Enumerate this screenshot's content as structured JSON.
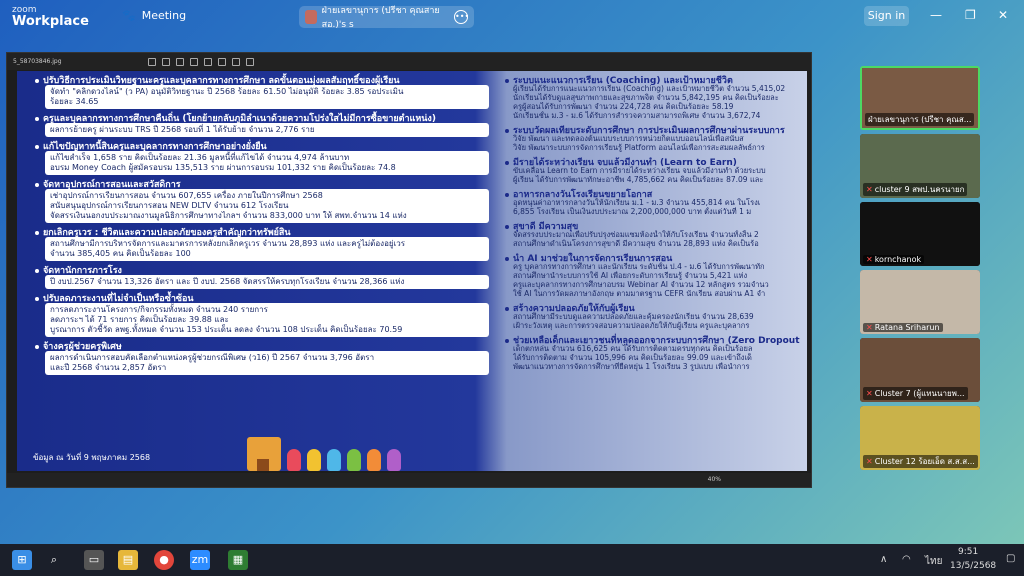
{
  "zoom": {
    "logo_line1": "zoom",
    "logo_line2": "Workplace",
    "meeting_label": "Meeting",
    "share_title": "ฝ่ายเลขานุการ (ปรีชา  คุณสาย สอ.)'s s",
    "sign_in": "Sign in",
    "win_min": "—",
    "win_restore": "❐",
    "win_close": "✕"
  },
  "viewer": {
    "filename": "5_58703846.jpg",
    "zoom_level": "40%"
  },
  "slide": {
    "left_sections": [
      {
        "heading": "ปรับวิธีการประเมินวิทยฐานะครูและบุคลากรทางการศึกษา ลดขั้นตอนมุ่งผลสัมฤทธิ์ของผู้เรียน",
        "lines": [
          "จัดทำ \"คลิกดวงไลน์\" (ว PA) อนุมัติวิทยฐานะ ปี 2568 ร้อยละ 61.50 ไม่อนุมัติ ร้อยละ 3.85 รอประเมิน",
          "ร้อยละ 34.65"
        ]
      },
      {
        "heading": "ครูและบุคลากรทางการศึกษาคืนถิ่น (โยกย้ายกลับภูมิลำเนาด้วยความโปร่งใสไม่มีการซื้อขายตำแหน่ง)",
        "lines": [
          "ผลการย้ายครู ผ่านระบบ TRS ปี 2568 รอบที่ 1 ได้รับย้าย จำนวน 2,776 ราย"
        ]
      },
      {
        "heading": "แก้ไขปัญหาหนี้สินครูและบุคลากรทางการศึกษาอย่างยั่งยืน",
        "lines": [
          "แก้ไขสำเร็จ 1,658 ราย คิดเป็นร้อยละ 21.36 มูลหนี้ที่แก้ไขได้ จำนวน 4,974 ล้านบาท",
          "อบรม Money Coach ผู้สมัครอบรม 135,513 ราย ผ่านการอบรม 101,332 ราย คิดเป็นร้อยละ 74.8"
        ]
      },
      {
        "heading": "จัดหาอุปกรณ์การสอนและสวัสดิการ",
        "lines": [
          "เช่าอุปกรณ์การเรียนการสอน จำนวน 607,655 เครื่อง ภายในปีการศึกษา 2568",
          "สนับสนุนอุปกรณ์การเรียนการสอน NEW DLTV จำนวน 612 โรงเรียน",
          "จัดสรรเงินนอกงบประมาณงานมูลนิธิการศึกษาทางไกลฯ จำนวน 833,000 บาท ให้ สพท.จำนวน 14 แห่ง"
        ]
      },
      {
        "heading": "ยกเลิกครูเวร : ชีวิตและความปลอดภัยของครูสำคัญกว่าทรัพย์สิน",
        "lines": [
          "สถานศึกษามีการบริหารจัดการและมาตรการหลังยกเลิกครูเวร จำนวน 28,893 แห่ง และครูไม่ต้องอยู่เวร",
          "จำนวน 385,405 คน คิดเป็นร้อยละ 100"
        ]
      },
      {
        "heading": "จัดหานักการภารโรง",
        "lines": [
          "ปี งบป.2567 จำนวน 13,326 อัตรา และ ปี งบป. 2568 จัดสรรให้ครบทุกโรงเรียน จำนวน 28,366 แห่ง"
        ]
      },
      {
        "heading": "ปรับลดภาระงานที่ไม่จำเป็นหรือซ้ำซ้อน",
        "lines": [
          "การลดภาระงานโครงการ/กิจกรรมทั้งหมด จำนวน 240 รายการ",
          "ลดภาระฯ ได้ 71 รายการ คิดเป็นร้อยละ 39.88 และ",
          "บูรณาการ ตัวชี้วัด ลพฐ.ทั้งหมด จำนวน 153 ประเด็น ลดลง จำนวน 108 ประเด็น คิดเป็นร้อยละ 70.59"
        ]
      },
      {
        "heading": "จ้างครูผู้ช่วยครูพิเศษ",
        "lines": [
          "ผลการดำเนินการสอบคัดเลือกตำแหน่งครูผู้ช่วยกรณีพิเศษ (ว16) ปี 2567 จำนวน 3,796 อัตรา",
          "และปี 2568 จำนวน 2,857 อัตรา"
        ]
      }
    ],
    "footnote": "ข้อมูล ณ วันที่ 9 พฤษภาคม 2568",
    "right_sections": [
      {
        "heading": "ระบบแนะแนวการเรียน (Coaching) และเป้าหมายชีวิต",
        "lines": [
          "ผู้เรียนได้รับการแนะแนวการเรียน (Coaching) และเป้าหมายชีวิต จำนวน 5,415,02",
          "นักเรียนได้รับดูแลสุขภาพกายและสุขภาพจิต จำนวน 5,842,195 คน คิดเป็นร้อยละ",
          "ครูผู้สอนได้รับการพัฒนา จำนวน 224,728 คน คิดเป็นร้อยละ 58.19",
          "นักเรียนชั้น ม.3 - ม.6 ได้รับการสำรวจความสามารถพิเศษ จำนวน 3,672,74"
        ]
      },
      {
        "heading": "ระบบวัดผลเทียบระดับการศึกษา การประเมินผลการศึกษาผ่านระบบการ",
        "lines": [
          "วิจัย พัฒนา และทดลองต้นแบบระบบการหน่วยกิตแบบออนไลน์เพื่อสนับส",
          "วิจัย พัฒนาระบบการจัดการเรียนรู้ Platform ออนไลน์เพื่อการสะสมผลลัพธ์การ"
        ]
      },
      {
        "heading": "มีรายได้ระหว่างเรียน จบแล้วมีงานทำ (Learn to Earn)",
        "lines": [
          "ขับเคลื่อน Learn to Earn การมีรายได้ระหว่างเรียน จบแล้วมีงานทำ ด้วยระบบ",
          "ผู้เรียน ได้รับการพัฒนาทักษะอาชีพ 4,785,662 คน คิดเป็นร้อยละ 87.09 และ"
        ]
      },
      {
        "heading": "อาหารกลางวันโรงเรียนขยายโอกาส",
        "lines": [
          "อุดหนุนค่าอาหารกลางวันให้นักเรียน ม.1 - ม.3 จำนวน 455,814 คน ในโรงเ",
          "6,855 โรงเรียน เป็นเงินงบประมาณ 2,200,000,000 บาท ตั้งแต่วันที่ 1 ม"
        ]
      },
      {
        "heading": "สุขาดี มีความสุข",
        "lines": [
          "จัดสรรงบประมาณเพื่อปรับปรุงซ่อมแซมห้องน้ำให้กับโรงเรียน จำนวนทั้งสิ้น 2",
          "สถานศึกษาดำเนินโครงการสุขาดี มีความสุข จำนวน 28,893 แห่ง คิดเป็นร้อ"
        ]
      },
      {
        "heading": "นำ AI มาช่วยในการจัดการเรียนการสอน",
        "lines": [
          "ครู บุคลากรทางการศึกษา และนักเรียน ระดับชั้น ป.4 - ม.6 ได้รับการพัฒนาทัก",
          "สถานศึกษานำระบบการใช้ AI เพื่อยกระดับการเรียนรู้ จำนวน 5,421 แห่ง",
          "ครูและบุคลากรทางการศึกษาอบรม Webinar AI จำนวน 12 หลักสูตร รวมจำนว",
          "ใช้ AI ในการวัดผลภาษาอังกฤษ ตามมาตรฐาน CEFR นักเรียน สอบผ่าน A1 จำ"
        ]
      },
      {
        "heading": "สร้างความปลอดภัยให้กับผู้เรียน",
        "lines": [
          "สถานศึกษามีระบบดูแลความปลอดภัยและคุ้มครองนักเรียน จำนวน 28,639",
          "เฝ้าระวังเหตุ และการตรวจสอบความปลอดภัยให้กับผู้เรียน ครูและบุคลากร"
        ]
      },
      {
        "heading": "ช่วยเหลือเด็กและเยาวชนที่หลุดออกจากระบบการศึกษา (Zero Dropout",
        "lines": [
          "เด็กตกหล่น จำนวน 616,625 คน ได้รับการติดตามครบทุกคน คิดเป็นร้อยล",
          "ได้รับการติดตาม จำนวน 105,996 คน คิดเป็นร้อยละ 99.09 และเข้าถึงเด็",
          "พัฒนาแนวทางการจัดการศึกษาที่ยืดหยุ่น 1 โรงเรียน 3 รูปแบบ เพื่อนำการ"
        ]
      }
    ]
  },
  "participants": [
    {
      "name": "ฝ่ายเลขานุการ (ปรีชา  คุณส...",
      "muted": false,
      "active": true,
      "scene": "#7a5a44"
    },
    {
      "name": "cluster 9 สพป.นครนายก",
      "muted": true,
      "active": false,
      "scene": "#5b6a4e"
    },
    {
      "name": "kornchanok",
      "muted": true,
      "active": false,
      "scene": "#111111"
    },
    {
      "name": "Ratana Sriharun",
      "muted": true,
      "active": false,
      "scene": "#c4b8a8"
    },
    {
      "name": "Cluster 7 (ผู้แทนนายพ...",
      "muted": true,
      "active": false,
      "scene": "#6b4e3a"
    },
    {
      "name": "Cluster 12 ร้อยเอ็ด ส.ส.ส...",
      "muted": true,
      "active": false,
      "scene": "#c9b24a"
    }
  ],
  "taskbar": {
    "lang": "ไทย",
    "time": "9:51",
    "date": "13/5/2568",
    "zoom_icon_text": "zm"
  }
}
